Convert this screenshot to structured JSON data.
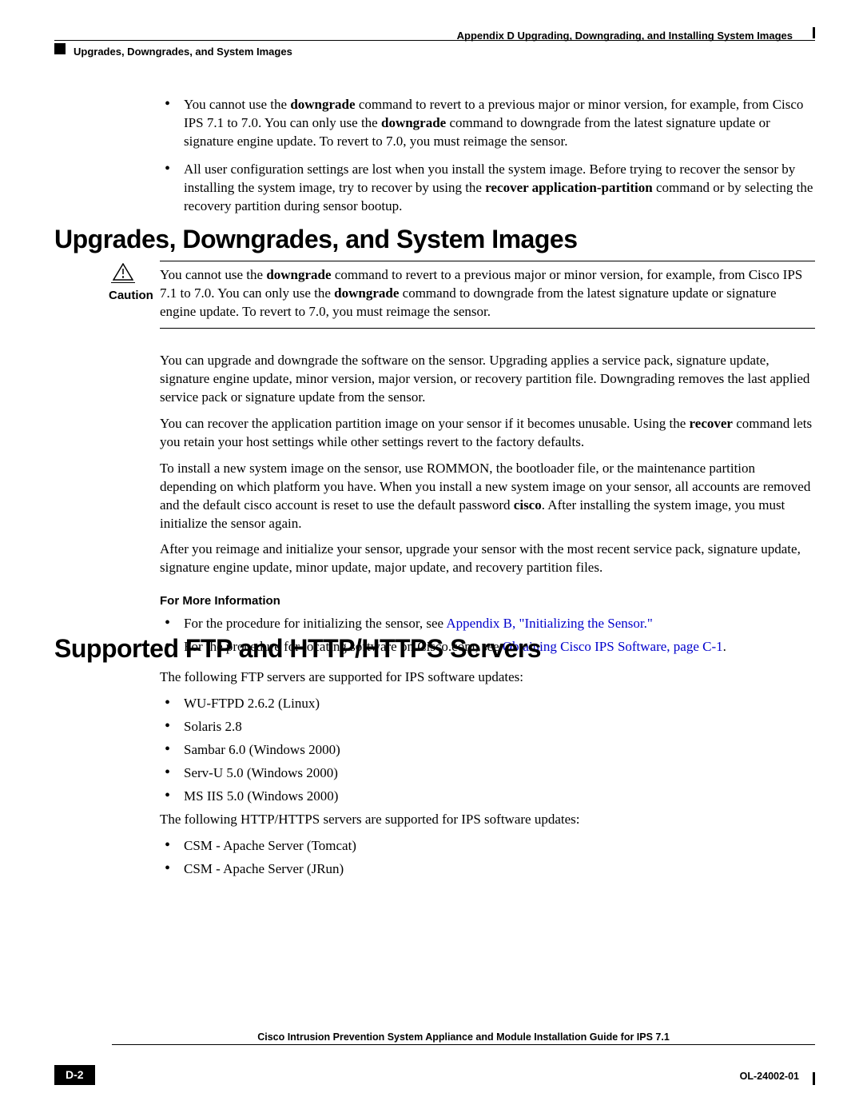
{
  "header": {
    "appendix": "Appendix D      Upgrading, Downgrading, and Installing System Images",
    "topic": "Upgrades, Downgrades, and System Images"
  },
  "top_bullets": [
    {
      "pre": "You cannot use the ",
      "b1": "downgrade",
      "mid1": " command to revert to a previous major or minor version, for example, from Cisco IPS 7.1 to 7.0. You can only use the ",
      "b2": "downgrade",
      "mid2": " command to downgrade from the latest signature update or signature engine update. To revert to 7.0, you must reimage the sensor."
    },
    {
      "pre": "All user configuration settings are lost when you install the system image. Before trying to recover the sensor by installing the system image, try to recover by using the ",
      "b1": "recover application-partition",
      "mid1": " command or by selecting the recovery partition during sensor bootup.",
      "b2": "",
      "mid2": ""
    }
  ],
  "section1_title": "Upgrades, Downgrades, and System Images",
  "caution": {
    "label": "Caution",
    "pre": "You cannot use the ",
    "b1": "downgrade",
    "mid1": " command to revert to a previous major or minor version, for example, from Cisco IPS 7.1 to 7.0. You can only use the ",
    "b2": "downgrade",
    "mid2": " command to downgrade from the latest signature update or signature engine update. To revert to 7.0, you must reimage the sensor."
  },
  "body1": {
    "p1": "You can upgrade and downgrade the software on the sensor. Upgrading applies a service pack, signature update, signature engine update, minor version, major version, or recovery partition file. Downgrading removes the last applied service pack or signature update from the sensor.",
    "p2_pre": "You can recover the application partition image on your sensor if it becomes unusable. Using the ",
    "p2_b": "recover",
    "p2_post": " command lets you retain your host settings while other settings revert to the factory defaults.",
    "p3_pre": "To install a new system image on the sensor, use ROMMON, the bootloader file, or the maintenance partition depending on which platform you have. When you install a new system image on your sensor, all accounts are removed and the default cisco account is reset to use the default password ",
    "p3_b": "cisco",
    "p3_post": ". After installing the system image, you must initialize the sensor again.",
    "p4": "After you reimage and initialize your sensor, upgrade your sensor with the most recent service pack, signature update, signature engine update, minor update, major update, and recovery partition files.",
    "more_info": "For More Information",
    "link_items": [
      {
        "pre": "For the procedure for initializing the sensor, see ",
        "link": "Appendix B, \"Initializing the Sensor.\""
      },
      {
        "pre": "For the procedure for locating software on Cisco.com, see ",
        "link": "Obtaining Cisco IPS Software, page C-1",
        "post": "."
      }
    ]
  },
  "section2_title": "Supported FTP and HTTP/HTTPS Servers",
  "body2": {
    "p1": "The following FTP servers are supported for IPS software updates:",
    "ftp": [
      "WU-FTPD 2.6.2 (Linux)",
      "Solaris 2.8",
      "Sambar 6.0 (Windows 2000)",
      "Serv-U 5.0 (Windows 2000)",
      "MS IIS 5.0 (Windows 2000)"
    ],
    "p2": "The following HTTP/HTTPS servers are supported for IPS software updates:",
    "http": [
      "CSM - Apache Server (Tomcat)",
      "CSM - Apache Server (JRun)"
    ]
  },
  "footer": {
    "title": "Cisco Intrusion Prevention System Appliance and Module Installation Guide for IPS 7.1",
    "page": "D-2",
    "doc": "OL-24002-01"
  }
}
